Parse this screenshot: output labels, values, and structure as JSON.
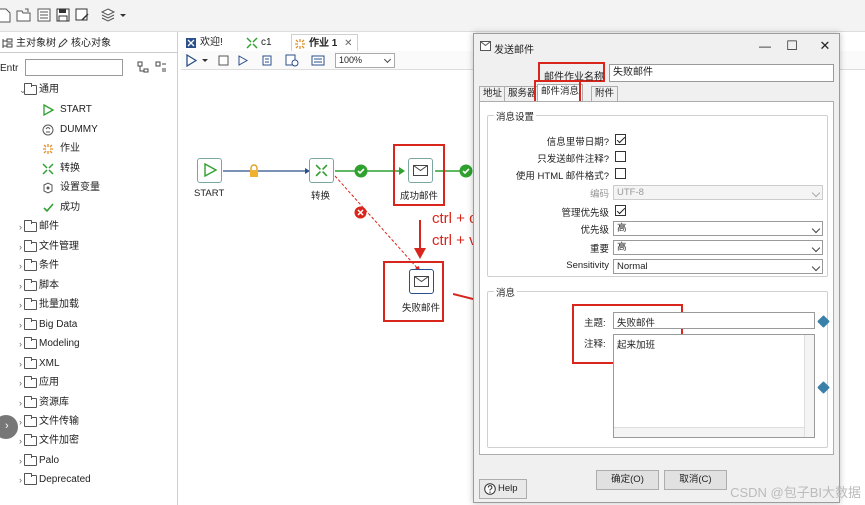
{
  "left_panel": {
    "tabs": [
      {
        "label": "主对象树",
        "icon": "main-tree-icon"
      },
      {
        "label": "核心对象",
        "icon": "pencil-icon"
      }
    ],
    "filter_label": "Entr",
    "tree": [
      {
        "label": "通用",
        "expanded": true,
        "children": [
          {
            "label": "START",
            "icon": "start-icon"
          },
          {
            "label": "DUMMY",
            "icon": "dummy-icon"
          },
          {
            "label": "作业",
            "icon": "job-icon"
          },
          {
            "label": "转换",
            "icon": "transform-icon"
          },
          {
            "label": "设置变量",
            "icon": "set-variable-icon"
          },
          {
            "label": "成功",
            "icon": "success-check-icon"
          }
        ]
      },
      {
        "label": "邮件"
      },
      {
        "label": "文件管理"
      },
      {
        "label": "条件"
      },
      {
        "label": "脚本"
      },
      {
        "label": "批量加载"
      },
      {
        "label": "Big Data"
      },
      {
        "label": "Modeling"
      },
      {
        "label": "XML"
      },
      {
        "label": "应用"
      },
      {
        "label": "资源库"
      },
      {
        "label": "文件传输"
      },
      {
        "label": "文件加密"
      },
      {
        "label": "Palo"
      },
      {
        "label": "Deprecated"
      }
    ]
  },
  "editor": {
    "tabs": [
      {
        "label": "欢迎!",
        "icon": "welcome-icon"
      },
      {
        "label": "c1",
        "icon": "transform-icon"
      },
      {
        "label": "作业 1",
        "icon": "job-icon",
        "active": true,
        "close": "✕"
      }
    ],
    "zoom": "100%"
  },
  "canvas": {
    "nodes": {
      "start": "START",
      "transform": "转换",
      "success_mail": "成功邮件",
      "fail_mail": "失败邮件"
    },
    "annotation_line1": "ctrl + c",
    "annotation_line2": "ctrl + v"
  },
  "dialog": {
    "title": "发送邮件",
    "mail_job_label": "邮件作业名称",
    "mail_job_value": "失败邮件",
    "tabs": [
      "地址",
      "服务器",
      "邮件消息",
      "附件"
    ],
    "active_tab": "邮件消息",
    "settings_group": "消息设置",
    "fields": {
      "date_in_message": {
        "label": "信息里带日期?",
        "checked": true
      },
      "only_comment": {
        "label": "只发送邮件注释?",
        "checked": false
      },
      "html_format": {
        "label": "使用 HTML 邮件格式?",
        "checked": false
      },
      "encoding": {
        "label": "编码",
        "value": "UTF-8"
      },
      "manage_priority": {
        "label": "管理优先级",
        "checked": true
      },
      "priority": {
        "label": "优先级",
        "value": "高"
      },
      "importance": {
        "label": "重要",
        "value": "高"
      },
      "sensitivity": {
        "label": "Sensitivity",
        "value": "Normal"
      }
    },
    "message_group": "消息",
    "subject_label": "主题:",
    "subject_value": "失败邮件",
    "comment_label": "注释:",
    "comment_value": "起来加班",
    "ok_button": "确定(O)",
    "cancel_button": "取消(C)",
    "help_button": "Help"
  },
  "watermark": "CSDN @包子BI大数据",
  "colors": {
    "annotation_red": "#d9261c",
    "hop_green": "#2fa12f",
    "node_border": "#7aa7a0"
  }
}
